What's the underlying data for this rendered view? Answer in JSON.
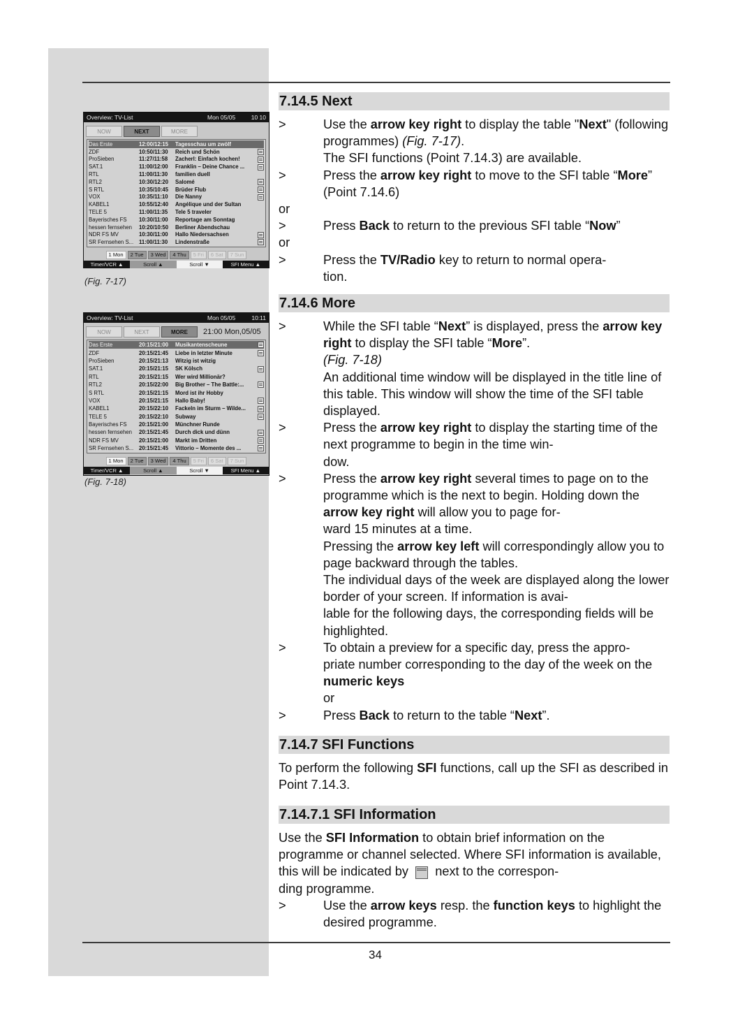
{
  "page": {
    "number": "34"
  },
  "figures": [
    {
      "caption": "(Fig. 7-17)",
      "title": "Overview: TV-List",
      "date": "Mon 05/05",
      "clock": "10 10",
      "tabs": [
        {
          "label": "NOW",
          "active": false
        },
        {
          "label": "NEXT",
          "active": true
        },
        {
          "label": "MORE",
          "active": false
        }
      ],
      "time_window": "",
      "rows": [
        {
          "channel": "Das Erste",
          "time": "12:00/12:15",
          "programme": "Tagesschau um zwölf",
          "info": false,
          "selected": true
        },
        {
          "channel": "ZDF",
          "time": "10:50/11:30",
          "programme": "Reich und Schön",
          "info": true,
          "selected": false
        },
        {
          "channel": "ProSieben",
          "time": "11:27/11:58",
          "programme": "Zacherl: Einfach kochen!",
          "info": true,
          "selected": false
        },
        {
          "channel": "SAT.1",
          "time": "11:00/12:00",
          "programme": "Franklin – Deine Chance ...",
          "info": true,
          "selected": false
        },
        {
          "channel": "RTL",
          "time": "11:00/11:30",
          "programme": "familien duell",
          "info": false,
          "selected": false
        },
        {
          "channel": "RTL2",
          "time": "10:30/12:20",
          "programme": "Salomé",
          "info": true,
          "selected": false
        },
        {
          "channel": "S RTL",
          "time": "10:35/10:45",
          "programme": "Brüder Flub",
          "info": true,
          "selected": false
        },
        {
          "channel": "VOX",
          "time": "10:35/11:10",
          "programme": "Die Nanny",
          "info": true,
          "selected": false
        },
        {
          "channel": "KABEL1",
          "time": "10:55/12:40",
          "programme": "Angélique und der Sultan",
          "info": false,
          "selected": false
        },
        {
          "channel": "TELE 5",
          "time": "11:00/11:35",
          "programme": "Tele 5 traveler",
          "info": false,
          "selected": false
        },
        {
          "channel": "Bayerisches FS",
          "time": "10:30/11:00",
          "programme": "Reportage am Sonntag",
          "info": false,
          "selected": false
        },
        {
          "channel": "hessen fernsehen",
          "time": "10:20/10:50",
          "programme": "Berliner Abendschau",
          "info": false,
          "selected": false
        },
        {
          "channel": "NDR FS MV",
          "time": "10:30/11:00",
          "programme": "Hallo Niedersachsen",
          "info": true,
          "selected": false
        },
        {
          "channel": "SR Fernsehen S...",
          "time": "11:00/11:30",
          "programme": "Lindenstraße",
          "info": true,
          "selected": false
        }
      ],
      "days": [
        {
          "label": "1 Mon",
          "state": "today"
        },
        {
          "label": "2 Tue",
          "state": "avail"
        },
        {
          "label": "3 Wed",
          "state": "avail"
        },
        {
          "label": "4 Thu",
          "state": "avail"
        },
        {
          "label": "5 Fri",
          "state": "none"
        },
        {
          "label": "6 Sat",
          "state": "none"
        },
        {
          "label": "7 Sun",
          "state": "none"
        }
      ],
      "keys": [
        "Timer/VCR ▲",
        "Scroll ▲",
        "Scroll ▼",
        "SFI Menu ▲"
      ]
    },
    {
      "caption": "(Fig. 7-18)",
      "title": "Overview: TV-List",
      "date": "Mon 05/05",
      "clock": "10:11",
      "tabs": [
        {
          "label": "NOW",
          "active": false
        },
        {
          "label": "NEXT",
          "active": false
        },
        {
          "label": "MORE",
          "active": true
        }
      ],
      "time_window": "21:00 Mon,05/05",
      "rows": [
        {
          "channel": "Das Erste",
          "time": "20:15/21:00",
          "programme": "Musikantenscheune",
          "info": true,
          "selected": true
        },
        {
          "channel": "ZDF",
          "time": "20:15/21:45",
          "programme": "Liebe in letzter Minute",
          "info": true,
          "selected": false
        },
        {
          "channel": "ProSieben",
          "time": "20:15/21:13",
          "programme": "Witzig ist witzig",
          "info": false,
          "selected": false
        },
        {
          "channel": "SAT.1",
          "time": "20:15/21:15",
          "programme": "SK Kölsch",
          "info": true,
          "selected": false
        },
        {
          "channel": "RTL",
          "time": "20:15/21:15",
          "programme": "Wer wird Millionär?",
          "info": false,
          "selected": false
        },
        {
          "channel": "RTL2",
          "time": "20:15/22:00",
          "programme": "Big Brother – The Battle:...",
          "info": true,
          "selected": false
        },
        {
          "channel": "S RTL",
          "time": "20:15/21:15",
          "programme": "Mord ist ihr Hobby",
          "info": false,
          "selected": false
        },
        {
          "channel": "VOX",
          "time": "20:15/21:15",
          "programme": "Hallo Baby!",
          "info": true,
          "selected": false
        },
        {
          "channel": "KABEL1",
          "time": "20:15/22:10",
          "programme": "Fackeln im Sturm – Wilde...",
          "info": true,
          "selected": false
        },
        {
          "channel": "TELE 5",
          "time": "20:15/22:10",
          "programme": "Subway",
          "info": true,
          "selected": false
        },
        {
          "channel": "Bayerisches FS",
          "time": "20:15/21:00",
          "programme": "Münchner Runde",
          "info": false,
          "selected": false
        },
        {
          "channel": "hessen fernsehen",
          "time": "20:15/21:45",
          "programme": "Durch dick und dünn",
          "info": true,
          "selected": false
        },
        {
          "channel": "NDR FS MV",
          "time": "20:15/21:00",
          "programme": "Markt im Dritten",
          "info": true,
          "selected": false
        },
        {
          "channel": "SR Fernsehen S...",
          "time": "20:15/21:45",
          "programme": "Vittorio – Momente des ...",
          "info": true,
          "selected": false
        }
      ],
      "days": [
        {
          "label": "1 Mon",
          "state": "today"
        },
        {
          "label": "2 Tue",
          "state": "avail"
        },
        {
          "label": "3 Wed",
          "state": "avail"
        },
        {
          "label": "4 Thu",
          "state": "avail"
        },
        {
          "label": "5 Fri",
          "state": "none"
        },
        {
          "label": "6 Sat",
          "state": "none"
        },
        {
          "label": "7 Sun",
          "state": "none"
        }
      ],
      "keys": [
        "Timer/VCR ▲",
        "Scroll ▲",
        "Scroll ▼",
        "SFI Menu ▲"
      ]
    }
  ],
  "sections": [
    {
      "heading": "7.14.5 Next",
      "blocks": [
        {
          "type": "item",
          "marker": ">",
          "html": "Use the <b>arrow key right</b> to display the table \"<b>Next</b>\" (following programmes) <i>(Fig. 7-17)</i>.<br>The SFI functions (Point 7.14.3) are available."
        },
        {
          "type": "item",
          "marker": ">",
          "html": "Press the <b>arrow key right</b> to move to the SFI table “<b>More</b>” (Point 7.14.6)"
        },
        {
          "type": "plain",
          "html": "or"
        },
        {
          "type": "item",
          "marker": ">",
          "html": "Press <b>Back</b> to return to the previous SFI table “<b>Now</b>”"
        },
        {
          "type": "plain",
          "html": "or"
        },
        {
          "type": "item",
          "marker": ">",
          "html": "Press the <b>TV/Radio</b> key to return to normal opera-<br>tion."
        }
      ]
    },
    {
      "heading": "7.14.6 More",
      "blocks": [
        {
          "type": "item",
          "marker": ">",
          "html": "While the SFI table “<b>Next</b>” is displayed, press the <b>arrow key right</b> to display the SFI table “<b>More</b>”.<br><i>(Fig. 7-18)</i><br>An additional time window will be displayed in the title line of this table. This window will show the time of the SFI table displayed."
        },
        {
          "type": "item",
          "marker": ">",
          "html": "Press the <b>arrow key right</b> to display the starting time of the next programme to begin in the time win-<br>dow."
        },
        {
          "type": "item",
          "marker": ">",
          "html": "Press the <b>arrow key right</b> several times to page on to the programme which is the next to begin. Holding down the <b>arrow key right</b> will allow you to page for-<br>ward 15 minutes at a time.<br>Pressing the <b>arrow key left</b> will correspondingly allow you to page backward through the tables.<br>The individual days of the week are displayed along the lower border of your screen. If information is avai-<br>lable for the following days, the corresponding fields will be highlighted."
        },
        {
          "type": "item",
          "marker": ">",
          "html": "To obtain a preview for a specific day, press the appro-<br>priate number corresponding to the day of the week on the <b>numeric keys</b><br>or"
        },
        {
          "type": "item",
          "marker": ">",
          "html": "Press <b>Back</b> to return to the table “<b>Next</b>”."
        }
      ]
    },
    {
      "heading": "7.14.7 SFI Functions",
      "blocks": [
        {
          "type": "plain",
          "html": "To perform the following <b>SFI</b> functions, call up the SFI as described in Point 7.14.3."
        }
      ]
    },
    {
      "heading": "7.14.7.1 SFI Information",
      "blocks": [
        {
          "type": "plain",
          "html": "Use the <b>SFI Information</b> to obtain brief information on the programme or channel selected. Where SFI information is available, this will be indicated by &nbsp;<span class=\"infoicon big\" data-name=\"sfi-info-icon\" data-interactable=\"false\"></span>&nbsp; next to the correspon-<br>ding programme."
        },
        {
          "type": "item",
          "marker": ">",
          "html": "Use the <b>arrow keys</b> resp. the <b>function keys</b> to highlight the desired programme."
        }
      ]
    }
  ]
}
